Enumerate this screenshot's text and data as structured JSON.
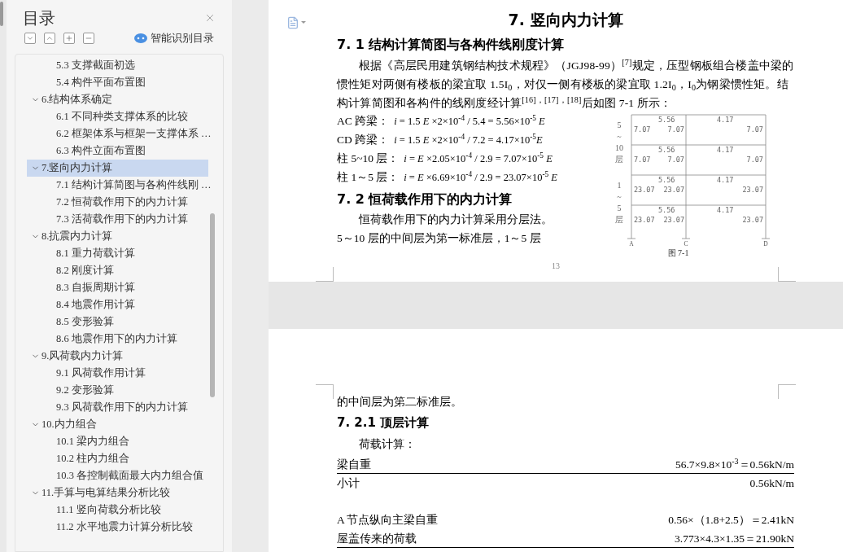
{
  "toc": {
    "title": "目录",
    "smart_button": "智能识别目录",
    "items": [
      {
        "children": [
          {
            "label": "5.3  支撑截面初选",
            "selected": false
          },
          {
            "label": "5.4  构件平面布置图",
            "selected": false
          }
        ]
      },
      {
        "label": "6.结构体系确定",
        "expanded": true,
        "selected": false,
        "children": [
          {
            "label": "6.1 不同种类支撑体系的比较",
            "selected": false
          },
          {
            "label": "6.2  框架体系与框架一支撑体系 …",
            "selected": false
          },
          {
            "label": "6.3  构件立面布置图",
            "selected": false
          }
        ]
      },
      {
        "label": "7.竖向内力计算",
        "expanded": true,
        "selected": true,
        "children": [
          {
            "label": "7.1  结构计算简图与各构件线刚 …",
            "selected": false
          },
          {
            "label": "7.2  恒荷载作用下的内力计算",
            "selected": false
          },
          {
            "label": "7.3  活荷载作用下的内力计算",
            "selected": false
          }
        ]
      },
      {
        "label": "8.抗震内力计算",
        "expanded": true,
        "selected": false,
        "children": [
          {
            "label": "8.1  重力荷载计算",
            "selected": false
          },
          {
            "label": "8.2  刚度计算",
            "selected": false
          },
          {
            "label": "8.3  自振周期计算",
            "selected": false
          },
          {
            "label": "8.4  地震作用计算",
            "selected": false
          },
          {
            "label": "8.5  变形验算",
            "selected": false
          },
          {
            "label": "8.6  地震作用下的内力计算",
            "selected": false
          }
        ]
      },
      {
        "label": "9.风荷载内力计算",
        "expanded": true,
        "selected": false,
        "children": [
          {
            "label": "9.1  风荷载作用计算",
            "selected": false
          },
          {
            "label": "9.2  变形验算",
            "selected": false
          },
          {
            "label": "9.3  风荷载作用下的内力计算",
            "selected": false
          }
        ]
      },
      {
        "label": "10.内力组合",
        "expanded": true,
        "selected": false,
        "children": [
          {
            "label": "10.1  梁内力组合",
            "selected": false
          },
          {
            "label": "10.2  柱内力组合",
            "selected": false
          },
          {
            "label": "10.3  各控制截面最大内力组合值",
            "selected": false
          }
        ]
      },
      {
        "label": "11.手算与电算结果分析比较",
        "expanded": true,
        "selected": false,
        "children": [
          {
            "label": "11.1  竖向荷载分析比较",
            "selected": false
          },
          {
            "label": "11.2  水平地震力计算分析比较",
            "selected": false
          }
        ]
      }
    ]
  },
  "page1": {
    "title": "7. 竖向内力计算",
    "heading1": "7. 1  结构计算简图与各构件线刚度计算",
    "paragraph": "根据《高层民用建筑钢结构技术规程》（JGJ98-99）$^{[7]}$规定，压型钢板组合楼盖中梁的惯性矩对两侧有楼板的梁宜取 1.5I$_{0}$，对仅一侧有楼板的梁宜取 1.2I$_{0}$，I$_{0}$为钢梁惯性矩。结构计算简图和各构件的线刚度经计算$^{[16]，[17]，[18]}$后如图 7-1 所示：",
    "formulas": [
      {
        "label": "AC 跨梁：",
        "expr": "*i* = 1.5 *E* ×2×10$^{-4}$ / 5.4 = 5.56×10$^{-5}$ *E*"
      },
      {
        "label": "CD 跨梁：",
        "expr": "*i* = 1.5 *E* ×2×10$^{-4}$ / 7.2 = 4.17×10$^{-5}$*E*"
      },
      {
        "label": "柱 5~10 层：",
        "expr": "*i* = *E* ×2.05×10$^{-4}$ / 2.9 = 7.07×10$^{-5}$ *E*"
      },
      {
        "label": "柱 1～5 层：",
        "expr": "*i* = *E* ×6.69×10$^{-4}$ / 2.9 = 23.07×10$^{-5}$ *E*"
      }
    ],
    "figure": {
      "floors": [
        {
          "ac": "5.56",
          "cd": "4.17",
          "col_a": "7.07",
          "col_c": "7.07",
          "col_d": "7.07"
        },
        {
          "ac": "5.56",
          "cd": "4.17",
          "col_a": "7.07",
          "col_c": "7.07",
          "col_d": "7.07"
        },
        {
          "ac": "5.56",
          "cd": "4.17",
          "col_a": "23.07",
          "col_c": "23.07",
          "col_d": "23.07"
        },
        {
          "ac": "5.56",
          "cd": "4.17",
          "col_a": "23.07",
          "col_c": "23.07",
          "col_d": "23.07"
        }
      ],
      "side_labels": [
        [
          "5",
          "~",
          "10",
          "层"
        ],
        [
          "1",
          "~",
          "5",
          "层"
        ]
      ],
      "axes": [
        "A",
        "C",
        "D"
      ],
      "caption": "图 7-1"
    },
    "heading2": "7. 2  恒荷载作用下的内力计算",
    "line1": "恒荷载作用下的内力计算采用分层法。",
    "line2": "5～10 层的中间层为第一标准层，1～5 层",
    "page_number": "13"
  },
  "page2": {
    "line": "的中间层为第二标准层。",
    "heading": "7. 2.1  顶层计算",
    "intro": "荷载计算：",
    "rows": [
      {
        "label": "梁自重",
        "value": "56.7×9.8×10$^{-3}$＝0.56kN/m",
        "underline": true
      },
      {
        "label": "小计",
        "value": "0.56kN/m",
        "underline": false
      },
      {
        "label": "A 节点纵向主梁自重",
        "value": "0.56×（1.8+2.5）＝2.41kN",
        "underline": false
      },
      {
        "label": "屋盖传来的荷载",
        "value": "3.773×4.3×1.35＝21.90kN",
        "underline": true
      }
    ]
  }
}
